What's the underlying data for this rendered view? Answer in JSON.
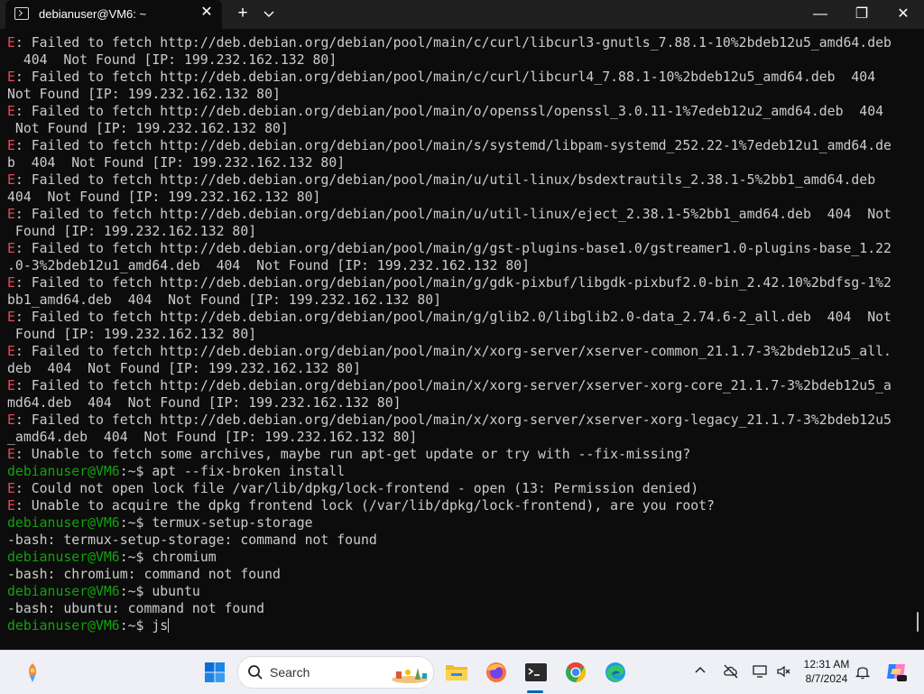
{
  "window": {
    "tab_title": "debianuser@VM6: ~",
    "tab_close": "✕",
    "new_tab": "+",
    "minimize": "—",
    "maximize": "❐",
    "close": "✕"
  },
  "terminal": {
    "lines": [
      {
        "type": "error",
        "prefix": "E",
        "text": ": Failed to fetch http://deb.debian.org/debian/pool/main/c/curl/libcurl3-gnutls_7.88.1-10%2bdeb12u5_amd64.deb"
      },
      {
        "type": "plain",
        "text": "  404  Not Found [IP: 199.232.162.132 80]"
      },
      {
        "type": "error",
        "prefix": "E",
        "text": ": Failed to fetch http://deb.debian.org/debian/pool/main/c/curl/libcurl4_7.88.1-10%2bdeb12u5_amd64.deb  404"
      },
      {
        "type": "plain",
        "text": "Not Found [IP: 199.232.162.132 80]"
      },
      {
        "type": "error",
        "prefix": "E",
        "text": ": Failed to fetch http://deb.debian.org/debian/pool/main/o/openssl/openssl_3.0.11-1%7edeb12u2_amd64.deb  404"
      },
      {
        "type": "plain",
        "text": " Not Found [IP: 199.232.162.132 80]"
      },
      {
        "type": "error",
        "prefix": "E",
        "text": ": Failed to fetch http://deb.debian.org/debian/pool/main/s/systemd/libpam-systemd_252.22-1%7edeb12u1_amd64.de"
      },
      {
        "type": "plain",
        "text": "b  404  Not Found [IP: 199.232.162.132 80]"
      },
      {
        "type": "error",
        "prefix": "E",
        "text": ": Failed to fetch http://deb.debian.org/debian/pool/main/u/util-linux/bsdextrautils_2.38.1-5%2bb1_amd64.deb"
      },
      {
        "type": "plain",
        "text": "404  Not Found [IP: 199.232.162.132 80]"
      },
      {
        "type": "error",
        "prefix": "E",
        "text": ": Failed to fetch http://deb.debian.org/debian/pool/main/u/util-linux/eject_2.38.1-5%2bb1_amd64.deb  404  Not"
      },
      {
        "type": "plain",
        "text": " Found [IP: 199.232.162.132 80]"
      },
      {
        "type": "error",
        "prefix": "E",
        "text": ": Failed to fetch http://deb.debian.org/debian/pool/main/g/gst-plugins-base1.0/gstreamer1.0-plugins-base_1.22"
      },
      {
        "type": "plain",
        "text": ".0-3%2bdeb12u1_amd64.deb  404  Not Found [IP: 199.232.162.132 80]"
      },
      {
        "type": "error",
        "prefix": "E",
        "text": ": Failed to fetch http://deb.debian.org/debian/pool/main/g/gdk-pixbuf/libgdk-pixbuf2.0-bin_2.42.10%2bdfsg-1%2"
      },
      {
        "type": "plain",
        "text": "bb1_amd64.deb  404  Not Found [IP: 199.232.162.132 80]"
      },
      {
        "type": "error",
        "prefix": "E",
        "text": ": Failed to fetch http://deb.debian.org/debian/pool/main/g/glib2.0/libglib2.0-data_2.74.6-2_all.deb  404  Not"
      },
      {
        "type": "plain",
        "text": " Found [IP: 199.232.162.132 80]"
      },
      {
        "type": "error",
        "prefix": "E",
        "text": ": Failed to fetch http://deb.debian.org/debian/pool/main/x/xorg-server/xserver-common_21.1.7-3%2bdeb12u5_all."
      },
      {
        "type": "plain",
        "text": "deb  404  Not Found [IP: 199.232.162.132 80]"
      },
      {
        "type": "error",
        "prefix": "E",
        "text": ": Failed to fetch http://deb.debian.org/debian/pool/main/x/xorg-server/xserver-xorg-core_21.1.7-3%2bdeb12u5_a"
      },
      {
        "type": "plain",
        "text": "md64.deb  404  Not Found [IP: 199.232.162.132 80]"
      },
      {
        "type": "error",
        "prefix": "E",
        "text": ": Failed to fetch http://deb.debian.org/debian/pool/main/x/xorg-server/xserver-xorg-legacy_21.1.7-3%2bdeb12u5"
      },
      {
        "type": "plain",
        "text": "_amd64.deb  404  Not Found [IP: 199.232.162.132 80]"
      },
      {
        "type": "error",
        "prefix": "E",
        "text": ": Unable to fetch some archives, maybe run apt-get update or try with --fix-missing?"
      },
      {
        "type": "prompt",
        "user": "debianuser@VM6",
        "path": ":~",
        "text": "$ apt --fix-broken install"
      },
      {
        "type": "error",
        "prefix": "E",
        "text": ": Could not open lock file /var/lib/dpkg/lock-frontend - open (13: Permission denied)"
      },
      {
        "type": "error",
        "prefix": "E",
        "text": ": Unable to acquire the dpkg frontend lock (/var/lib/dpkg/lock-frontend), are you root?"
      },
      {
        "type": "prompt",
        "user": "debianuser@VM6",
        "path": ":~",
        "text": "$ termux-setup-storage"
      },
      {
        "type": "plain",
        "text": "-bash: termux-setup-storage: command not found"
      },
      {
        "type": "prompt",
        "user": "debianuser@VM6",
        "path": ":~",
        "text": "$ chromium"
      },
      {
        "type": "plain",
        "text": "-bash: chromium: command not found"
      },
      {
        "type": "prompt",
        "user": "debianuser@VM6",
        "path": ":~",
        "text": "$ ubuntu"
      },
      {
        "type": "plain",
        "text": "-bash: ubuntu: command not found"
      },
      {
        "type": "prompt",
        "user": "debianuser@VM6",
        "path": ":~",
        "text": "$ js",
        "cursor": true
      }
    ]
  },
  "taskbar": {
    "search_placeholder": "Search",
    "time": "12:31 AM",
    "date": "8/7/2024",
    "apps": [
      "weather-icon",
      "start-icon",
      "file-explorer-icon",
      "firefox-icon",
      "terminal-icon",
      "chrome-icon",
      "edge-icon"
    ]
  },
  "colors": {
    "terminal_bg": "#0c0c0c",
    "terminal_fg": "#cccccc",
    "error_prefix": "#e74856",
    "prompt_user": "#13a10e",
    "taskbar_bg": "#eef0f5",
    "active_indicator": "#0067c0"
  }
}
